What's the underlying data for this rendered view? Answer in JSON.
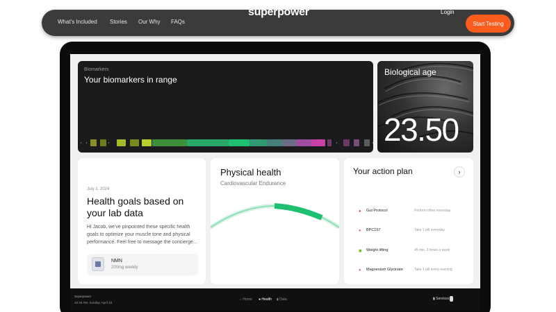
{
  "nav": {
    "links": [
      "What's Included",
      "Stories",
      "Our Why",
      "FAQs"
    ],
    "brand": "superpower",
    "login": "Login",
    "cta": "Start Testing"
  },
  "biomarkers": {
    "eyebrow": "Biomarkers",
    "title": "Your biomarkers in range"
  },
  "bio_age": {
    "label": "Biological age",
    "value": "23.50"
  },
  "goals": {
    "date": "July 1, 2024",
    "title": "Health goals based on your lab data",
    "body": "Hi Jacob, we've pinpointed these specific health goals to optimize your muscle tone and physical performance. Feel free to message the concierge...",
    "supplement": {
      "name": "NMN",
      "dose": "200mg weekly"
    }
  },
  "physical": {
    "title": "Physical health",
    "subtitle": "Cardiovascular Endurance"
  },
  "plan": {
    "title": "Your action plan",
    "next_glyph": "›",
    "items": [
      {
        "icon": "drop-icon",
        "glyph": "●",
        "color": "#e8462b",
        "name": "Gut Protocol",
        "schedule": "Perform other everyday"
      },
      {
        "icon": "pill-icon",
        "glyph": "●",
        "color": "#e05ba6",
        "name": "BPC157",
        "schedule": "Take 1 pill everyday"
      },
      {
        "icon": "dumbbell-icon",
        "glyph": "▮▮",
        "color": "#7bbf2a",
        "name": "Weight lifting",
        "schedule": "45 min, 3 times a week"
      },
      {
        "icon": "pill-icon",
        "glyph": "●",
        "color": "#e05ba6",
        "name": "Magnesium Glycinate",
        "schedule": "Take 1 pill every evening"
      }
    ]
  },
  "dock": {
    "brand": "Superpower",
    "time": "10:46 AM, Sunday, April 18",
    "items": [
      "Home",
      "Health",
      "Data"
    ],
    "active": "Health",
    "services": "Services"
  },
  "colors": {
    "cta": "#fa5c1e",
    "accent_green": "#1fbf72",
    "accent_magenta": "#d3309a"
  }
}
